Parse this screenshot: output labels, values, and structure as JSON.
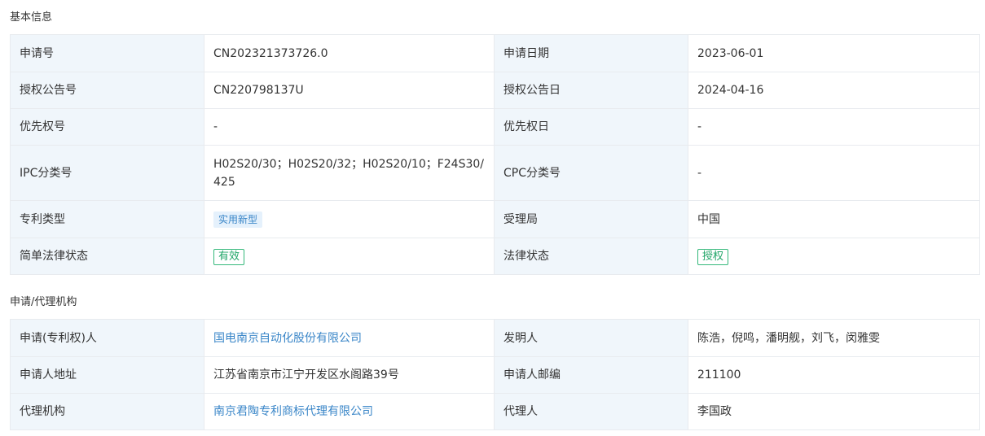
{
  "basic_info": {
    "title": "基本信息",
    "app_no_label": "申请号",
    "app_no": "CN202321373726.0",
    "app_date_label": "申请日期",
    "app_date": "2023-06-01",
    "grant_no_label": "授权公告号",
    "grant_no": "CN220798137U",
    "grant_date_label": "授权公告日",
    "grant_date": "2024-04-16",
    "priority_no_label": "优先权号",
    "priority_no": "-",
    "priority_date_label": "优先权日",
    "priority_date": "-",
    "ipc_label": "IPC分类号",
    "ipc": "H02S20/30；H02S20/32；H02S20/10；F24S30/425",
    "cpc_label": "CPC分类号",
    "cpc": "-",
    "patent_type_label": "专利类型",
    "patent_type": "实用新型",
    "office_label": "受理局",
    "office": "中国",
    "simple_status_label": "简单法律状态",
    "simple_status": "有效",
    "legal_status_label": "法律状态",
    "legal_status": "授权"
  },
  "agency": {
    "title": "申请/代理机构",
    "applicant_label": "申请(专利权)人",
    "applicant": "国电南京自动化股份有限公司",
    "inventor_label": "发明人",
    "inventors": "陈浩，倪鸣，潘明舰，刘飞，闵雅雯",
    "address_label": "申请人地址",
    "address": "江苏省南京市江宁开发区水阁路39号",
    "zip_label": "申请人邮编",
    "zip": "211100",
    "agency_label": "代理机构",
    "agency_name": "南京君陶专利商标代理有限公司",
    "agent_label": "代理人",
    "agent": "李国政"
  },
  "colors": {
    "label_bg": "#f0f6fb",
    "border": "#e8ebef",
    "link": "#3a86c8",
    "tag_green": "#1fa567"
  }
}
